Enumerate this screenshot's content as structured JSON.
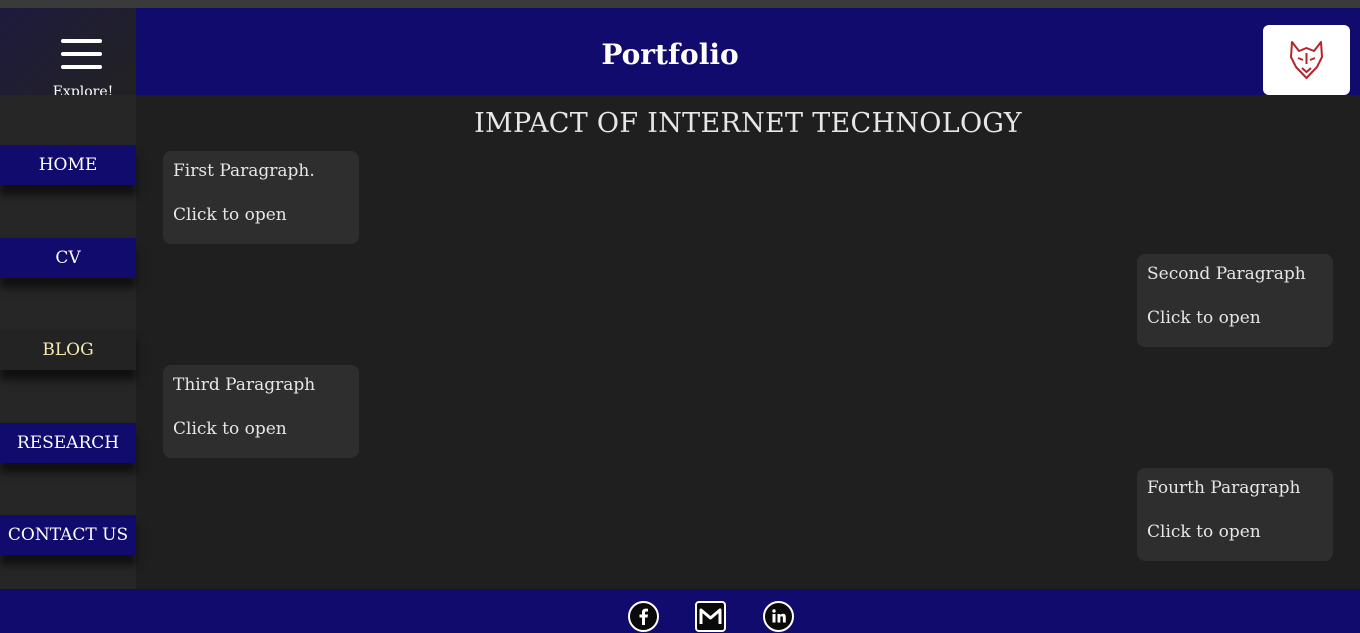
{
  "header": {
    "menu_label": "Explore!",
    "title": "Portfolio",
    "logo_icon": "wolf-logo-icon"
  },
  "sidebar": {
    "items": [
      {
        "label": "HOME"
      },
      {
        "label": "CV"
      },
      {
        "label": "BLOG",
        "active": true
      },
      {
        "label": "RESEARCH"
      },
      {
        "label": "CONTACT US"
      }
    ]
  },
  "main": {
    "title": "IMPACT OF INTERNET TECHNOLOGY",
    "cards": [
      {
        "title": "First Paragraph.",
        "action": "Click to open"
      },
      {
        "title": "Second Paragraph",
        "action": "Click to open"
      },
      {
        "title": "Third Paragraph",
        "action": "Click to open"
      },
      {
        "title": "Fourth Paragraph",
        "action": "Click to open"
      }
    ]
  },
  "footer": {
    "icons": [
      "facebook-icon",
      "gmail-icon",
      "linkedin-icon"
    ]
  },
  "colors": {
    "brand": "#100b6d",
    "background": "#1f1f1f",
    "card": "#2e2e2e",
    "active_nav_text": "#f6e9b0",
    "logo": "#b3262c"
  }
}
